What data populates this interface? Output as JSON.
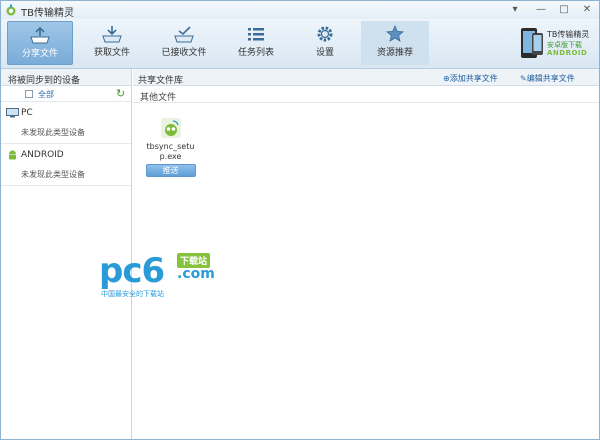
{
  "window": {
    "title": "TB传输精灵"
  },
  "controls": {
    "menu": "▾",
    "minimize": "—",
    "maximize": "□",
    "close": "✕"
  },
  "toolbar": {
    "tabs": [
      {
        "label": "分享文件"
      },
      {
        "label": "获取文件"
      },
      {
        "label": "已接收文件"
      },
      {
        "label": "任务列表"
      },
      {
        "label": "设置"
      },
      {
        "label": "资源推荐"
      }
    ],
    "promo": {
      "title": "TB传输精灵",
      "subtitle": "安卓版下载",
      "brand": "ANDROID"
    }
  },
  "left_panel": {
    "header": "将被同步到的设备",
    "select_all": "全部",
    "groups": [
      {
        "name": "PC",
        "empty_text": "未发现此类型设备"
      },
      {
        "name": "ANDROID",
        "empty_text": "未发现此类型设备"
      }
    ]
  },
  "right_panel": {
    "header": "共享文件库",
    "add_action": "添加共享文件",
    "edit_action": "编辑共享文件",
    "section": "其他文件",
    "file": {
      "name": "tbsync_setup.exe",
      "button": "推送"
    }
  },
  "watermark": {
    "main": "pc6",
    "tag": "下载站",
    "suffix": ".com",
    "slogan": "中国最安全的下载站"
  },
  "colors": {
    "accent": "#79acd8",
    "link": "#1f5c9d",
    "green": "#3f9a2c",
    "watermark": "#2a9bd8"
  }
}
